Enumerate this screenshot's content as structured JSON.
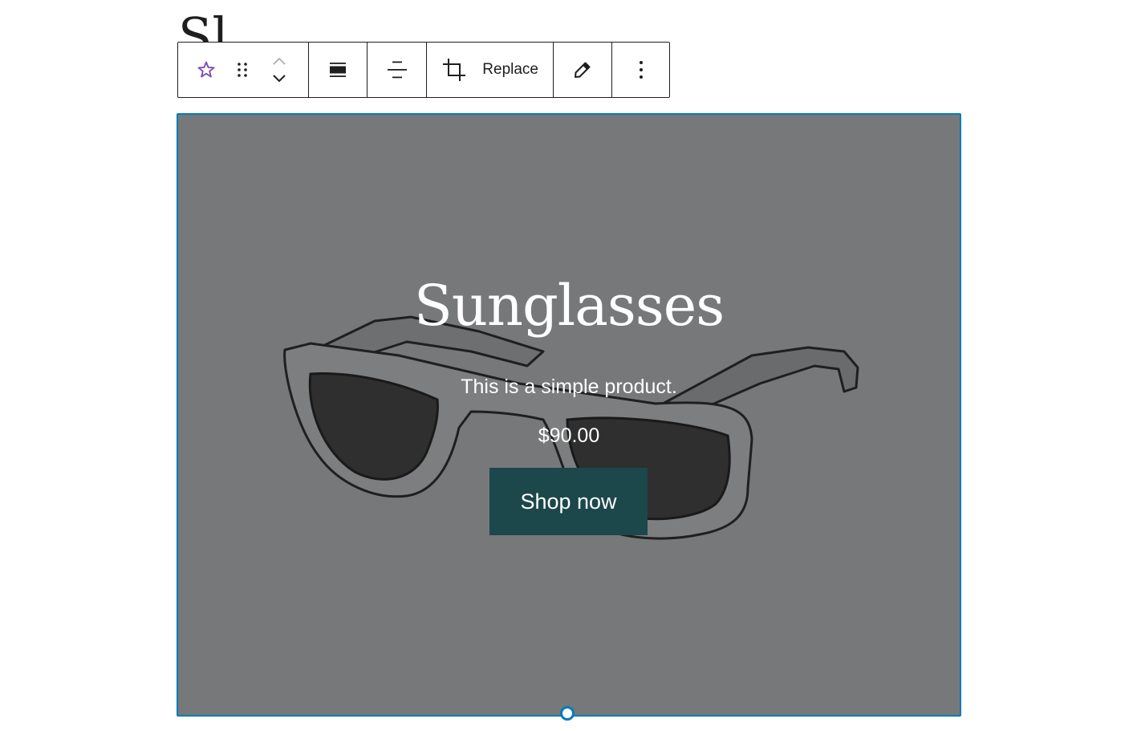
{
  "partial_heading": "Sl",
  "toolbar": {
    "replace_label": "Replace",
    "icons": {
      "block": "star-icon",
      "drag": "drag-handle-icon",
      "move_up": "chevron-up-icon",
      "move_down": "chevron-down-icon",
      "align": "align-full-width-icon",
      "vertical_align": "align-vertical-center-icon",
      "crop": "crop-icon",
      "edit": "pencil-icon",
      "more": "more-vertical-icon"
    },
    "accent_color": "#7a45b5"
  },
  "cover": {
    "title": "Sunglasses",
    "description": "This is a simple product.",
    "price": "$90.00",
    "button_label": "Shop now",
    "overlay_color": "#77787a",
    "button_color": "#1c474b",
    "selection_color": "#007cba"
  }
}
